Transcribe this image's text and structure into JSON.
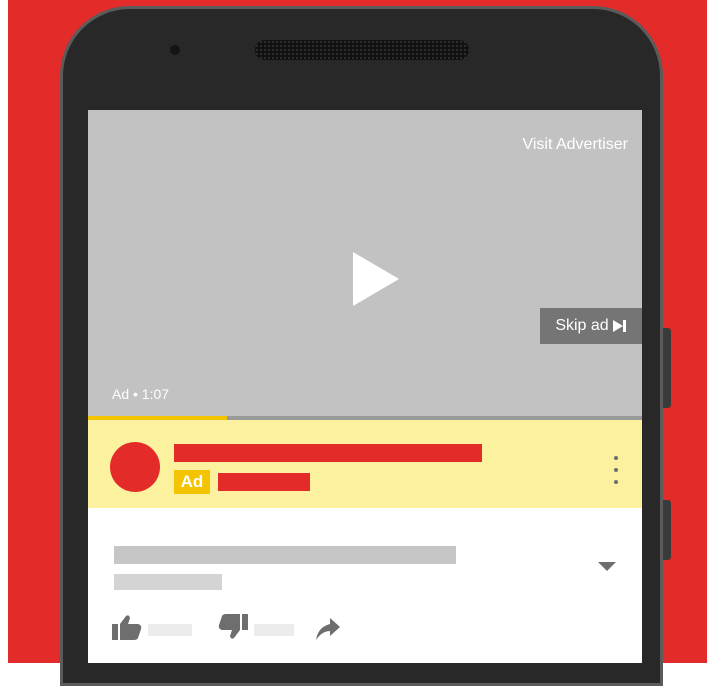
{
  "video": {
    "visit_label": "Visit Advertiser",
    "skip_label": "Skip ad",
    "ad_time": "Ad • 1:07",
    "progress_fraction": 0.25,
    "play_icon": "play-icon",
    "skip_icon": "skip-next-icon"
  },
  "ad_panel": {
    "badge_label": "Ad",
    "menu_icon": "more-vert-icon"
  },
  "details": {
    "expand_icon": "chevron-down-icon",
    "like_icon": "thumb-up-icon",
    "dislike_icon": "thumb-down-icon",
    "share_icon": "share-icon"
  },
  "colors": {
    "brand_red": "#e32b29",
    "ad_yellow": "#f5c400",
    "ad_panel_bg": "#fbf19e",
    "video_bg": "#c2c2c2"
  }
}
